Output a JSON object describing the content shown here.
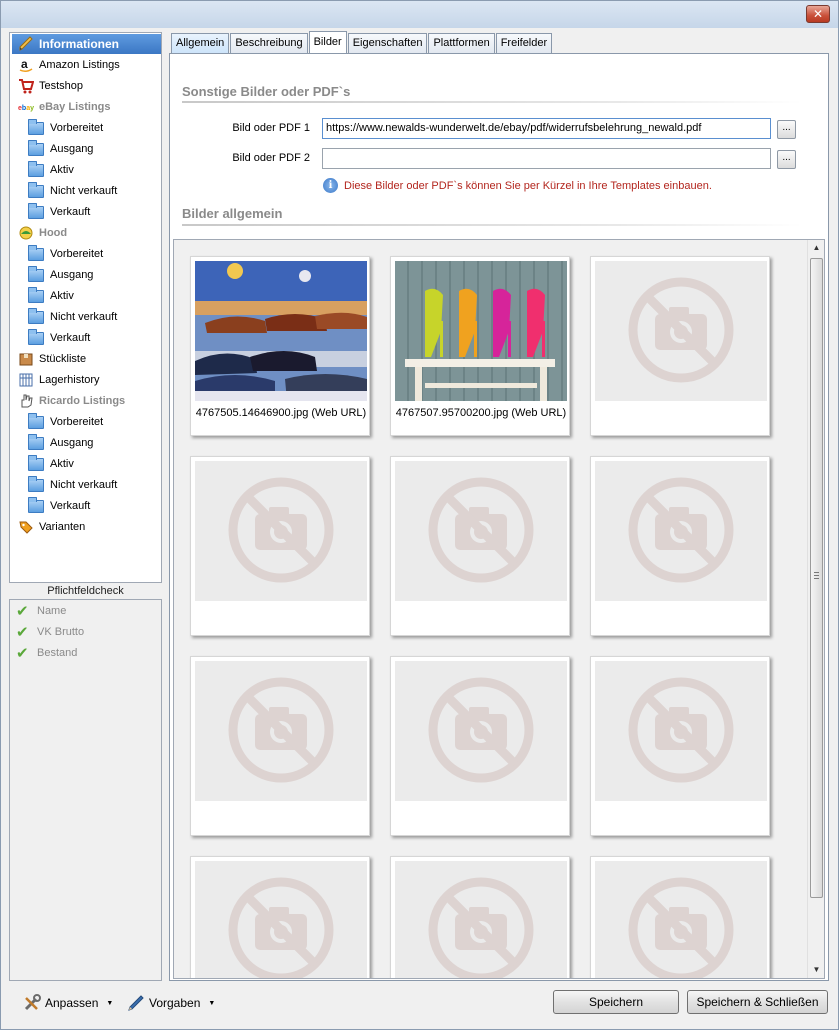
{
  "window": {
    "close_glyph": "✕"
  },
  "nav": {
    "items": [
      {
        "label": "Informationen",
        "icon": "pencil-icon",
        "level": 0,
        "active": true
      },
      {
        "label": "Amazon Listings",
        "icon": "amazon-icon",
        "level": 0
      },
      {
        "label": "Testshop",
        "icon": "shopping-cart-icon",
        "level": 0
      },
      {
        "label": "eBay Listings",
        "icon": "ebay-icon",
        "level": 0,
        "group": true
      },
      {
        "label": "Vorbereitet",
        "icon": "folder-icon",
        "level": 1
      },
      {
        "label": "Ausgang",
        "icon": "folder-icon",
        "level": 1
      },
      {
        "label": "Aktiv",
        "icon": "folder-icon",
        "level": 1
      },
      {
        "label": "Nicht verkauft",
        "icon": "folder-icon",
        "level": 1
      },
      {
        "label": "Verkauft",
        "icon": "folder-icon",
        "level": 1
      },
      {
        "label": "Hood",
        "icon": "hood-icon",
        "level": 0,
        "group": true
      },
      {
        "label": "Vorbereitet",
        "icon": "folder-icon",
        "level": 1
      },
      {
        "label": "Ausgang",
        "icon": "folder-icon",
        "level": 1
      },
      {
        "label": "Aktiv",
        "icon": "folder-icon",
        "level": 1
      },
      {
        "label": "Nicht verkauft",
        "icon": "folder-icon",
        "level": 1
      },
      {
        "label": "Verkauft",
        "icon": "folder-icon",
        "level": 1
      },
      {
        "label": "Stückliste",
        "icon": "box-icon",
        "level": 0
      },
      {
        "label": "Lagerhistory",
        "icon": "table-icon",
        "level": 0
      },
      {
        "label": "Ricardo Listings",
        "icon": "ricardo-hand-icon",
        "level": 0,
        "group": true
      },
      {
        "label": "Vorbereitet",
        "icon": "folder-icon",
        "level": 1
      },
      {
        "label": "Ausgang",
        "icon": "folder-icon",
        "level": 1
      },
      {
        "label": "Aktiv",
        "icon": "folder-icon",
        "level": 1
      },
      {
        "label": "Nicht verkauft",
        "icon": "folder-icon",
        "level": 1
      },
      {
        "label": "Verkauft",
        "icon": "folder-icon",
        "level": 1
      },
      {
        "label": "Varianten",
        "icon": "tags-icon",
        "level": 0
      }
    ]
  },
  "pflichtfeldcheck": {
    "title": "Pflichtfeldcheck",
    "items": [
      "Name",
      "VK Brutto",
      "Bestand"
    ]
  },
  "tabs": [
    {
      "label": "Allgemein",
      "state": "highlight"
    },
    {
      "label": "Beschreibung",
      "state": "normal"
    },
    {
      "label": "Bilder",
      "state": "selected"
    },
    {
      "label": "Eigenschaften",
      "state": "normal"
    },
    {
      "label": "Plattformen",
      "state": "normal"
    },
    {
      "label": "Freifelder",
      "state": "normal"
    }
  ],
  "sonstige": {
    "title": "Sonstige Bilder oder PDF`s",
    "field1_label": "Bild oder PDF 1",
    "field1_value": "https://www.newalds-wunderwelt.de/ebay/pdf/widerrufsbelehrung_newald.pdf",
    "field2_label": "Bild oder PDF 2",
    "field2_value": "",
    "browse_label": "...",
    "info_text": "Diese Bilder oder PDF`s können Sie per Kürzel in Ihre Templates einbauen."
  },
  "bilder": {
    "title": "Bilder allgemein",
    "images": [
      {
        "caption": "4767505.14646900.jpg (Web URL)",
        "kind": "shoes-photo"
      },
      {
        "caption": "4767507.95700200.jpg (Web URL)",
        "kind": "heels-photo"
      },
      {
        "caption": "",
        "kind": "placeholder"
      },
      {
        "caption": "",
        "kind": "placeholder"
      },
      {
        "caption": "",
        "kind": "placeholder"
      },
      {
        "caption": "",
        "kind": "placeholder"
      },
      {
        "caption": "",
        "kind": "placeholder"
      },
      {
        "caption": "",
        "kind": "placeholder"
      },
      {
        "caption": "",
        "kind": "placeholder"
      },
      {
        "caption": "",
        "kind": "placeholder"
      },
      {
        "caption": "",
        "kind": "placeholder"
      },
      {
        "caption": "",
        "kind": "placeholder"
      }
    ]
  },
  "toolbar": {
    "anpassen_label": "Anpassen",
    "vorgaben_label": "Vorgaben",
    "save_label": "Speichern",
    "save_close_label": "Speichern & Schließen"
  },
  "colors": {
    "accent": "#3b77c4",
    "info_text": "#b3261e",
    "check": "#5aa83a"
  }
}
